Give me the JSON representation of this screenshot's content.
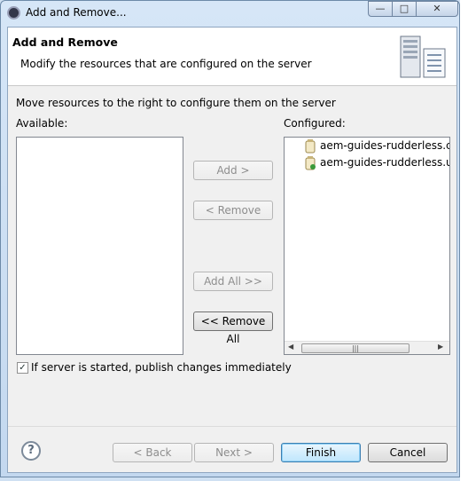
{
  "window": {
    "title": "Add and Remove...",
    "minimize": "—",
    "maximize": "□",
    "close": "✕"
  },
  "header": {
    "title": "Add and Remove",
    "description": "Modify the resources that are configured on the server",
    "illustration_icon": "server-icon"
  },
  "body": {
    "instruction": "Move resources to the right to configure them on the server",
    "available_label": "Available:",
    "available_items": [],
    "configured_label": "Configured:",
    "configured_items": [
      {
        "label": "aem-guides-rudderless.core",
        "icon": "bundle-jar-icon"
      },
      {
        "label": "aem-guides-rudderless.ui.c",
        "icon": "content-package-icon"
      }
    ],
    "scrollbar": {
      "left_arrow": "◀",
      "thumb_grip": "|||",
      "right_arrow": "▶"
    }
  },
  "buttons": {
    "add": "Add >",
    "remove": "< Remove",
    "add_all": "Add All >>",
    "remove_all": "<< Remove All"
  },
  "options": {
    "publish_immediately_label": "If server is started, publish changes immediately",
    "publish_immediately_checked": true,
    "check_mark": "✓"
  },
  "footer": {
    "help": "?",
    "back": "< Back",
    "next": "Next >",
    "finish": "Finish",
    "cancel": "Cancel"
  },
  "colors": {
    "default_button": "#bee6fd",
    "disabled_text": "#8d8d8d"
  }
}
